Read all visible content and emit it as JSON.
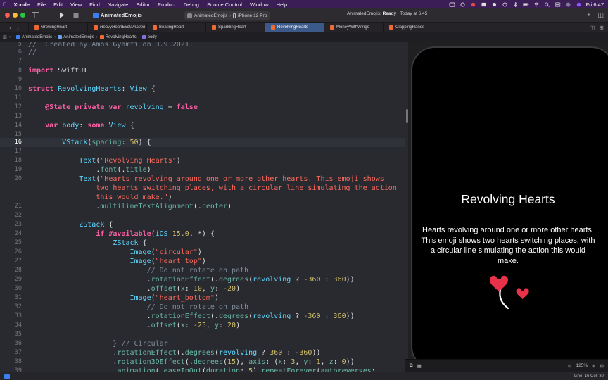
{
  "menubar": {
    "items": [
      "Xcode",
      "File",
      "Edit",
      "View",
      "Find",
      "Navigate",
      "Editor",
      "Product",
      "Debug",
      "Source Control",
      "Window",
      "Help"
    ],
    "clock": "Fri 6.47"
  },
  "toolbar": {
    "scheme_name": "AnimatedEmojis",
    "destination_app": "AnimatedEmojis",
    "destination_device": "iPhone 12 Pro",
    "status_app": "AnimatedEmojis:",
    "status_state": "Ready",
    "status_time": "| Today at 6.45"
  },
  "tabs": [
    {
      "label": "GrowingHeart"
    },
    {
      "label": "HeavyHeartExclamation"
    },
    {
      "label": "BeatingHeart"
    },
    {
      "label": "SparklingHeart"
    },
    {
      "label": "RevolvingHearts"
    },
    {
      "label": "MoneyWithWings"
    },
    {
      "label": "ClappingHands"
    }
  ],
  "jumpbar": {
    "project": "AnimatedEmojis",
    "group": "AnimatedEmojis",
    "file": "RevolvingHearts",
    "symbol": "body"
  },
  "editor": {
    "current_line": 16,
    "line_numbers": [
      "5",
      "6",
      "7",
      "8",
      "9",
      "10",
      "11",
      "12",
      "13",
      "14",
      "15",
      "16",
      "17",
      "18",
      "19",
      "20",
      "",
      "21",
      "22",
      "23",
      "24",
      "25",
      "26",
      "27",
      "28",
      "29",
      "30",
      "31",
      "32",
      "33",
      "34",
      "35",
      "36",
      "37",
      "38",
      "39"
    ]
  },
  "preview": {
    "title": "Revolving Hearts",
    "body": "Hearts revolving around one or more other hearts. This emoji shows two hearts switching places, with a circular line simulating the action this would make.",
    "zoom": "125%"
  },
  "statusbar": {
    "position": "Line: 16  Col: 30"
  },
  "colors": {
    "menubar": "#3a1e55",
    "keyword": "#fc5fa3",
    "type": "#5dd8ff",
    "string": "#fc6a5d",
    "comment": "#7f8c98",
    "number": "#d0bf69",
    "active_tab": "#3b5a8a",
    "heart": "#e8324a"
  }
}
